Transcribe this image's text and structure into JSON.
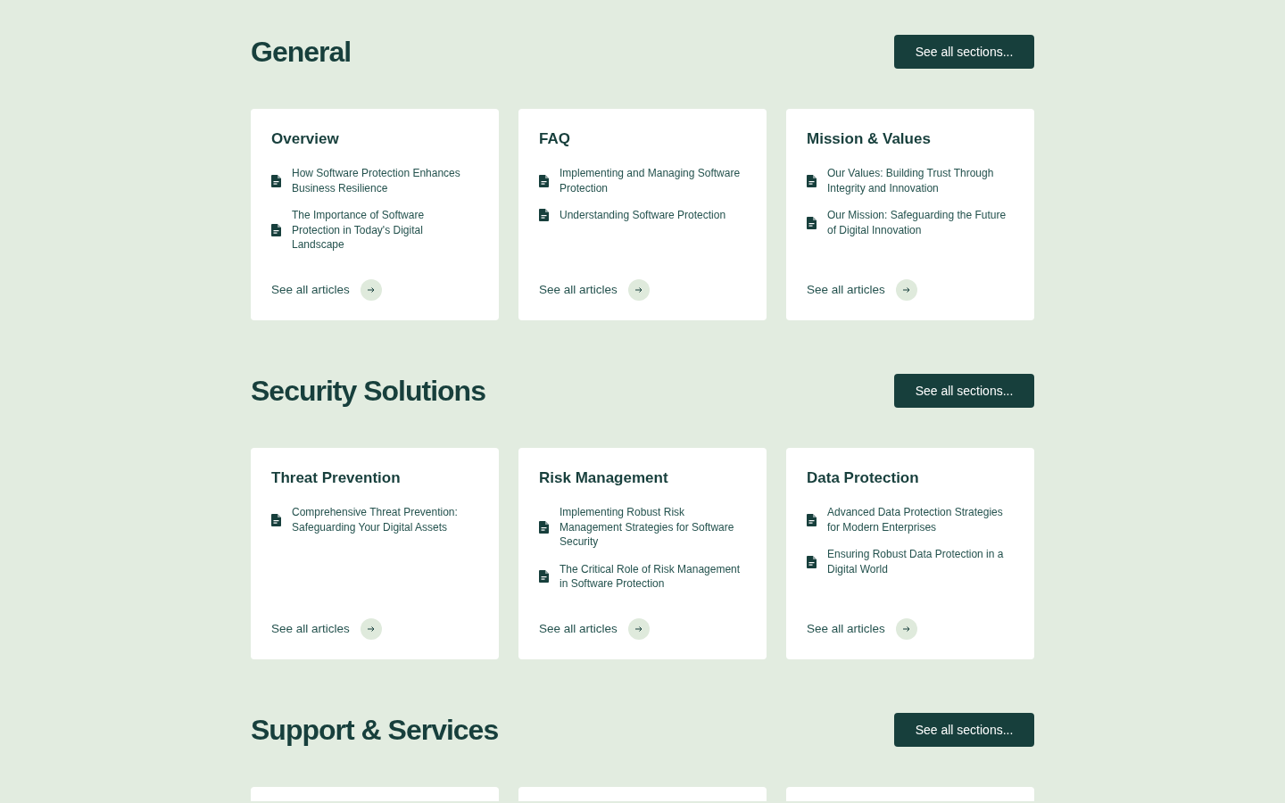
{
  "sections": [
    {
      "title": "General",
      "button": "See all sections...",
      "cards": [
        {
          "title": "Overview",
          "articles": [
            "How Software Protection Enhances Business Resilience",
            "The Importance of Software Protection in Today's Digital Landscape"
          ],
          "link": "See all articles"
        },
        {
          "title": "FAQ",
          "articles": [
            "Implementing and Managing Software Protection",
            "Understanding Software Protection"
          ],
          "link": "See all articles"
        },
        {
          "title": "Mission & Values",
          "articles": [
            "Our Values: Building Trust Through Integrity and Innovation",
            "Our Mission: Safeguarding the Future of Digital Innovation"
          ],
          "link": "See all articles"
        }
      ]
    },
    {
      "title": "Security Solutions",
      "button": "See all sections...",
      "cards": [
        {
          "title": "Threat Prevention",
          "articles": [
            "Comprehensive Threat Prevention: Safeguarding Your Digital Assets"
          ],
          "link": "See all articles"
        },
        {
          "title": "Risk Management",
          "articles": [
            "Implementing Robust Risk Management Strategies for Software Security",
            "The Critical Role of Risk Management in Software Protection"
          ],
          "link": "See all articles"
        },
        {
          "title": "Data Protection",
          "articles": [
            "Advanced Data Protection Strategies for Modern Enterprises",
            "Ensuring Robust Data Protection in a Digital World"
          ],
          "link": "See all articles"
        }
      ]
    },
    {
      "title": "Support & Services",
      "button": "See all sections...",
      "cards_cut_off": true
    }
  ]
}
